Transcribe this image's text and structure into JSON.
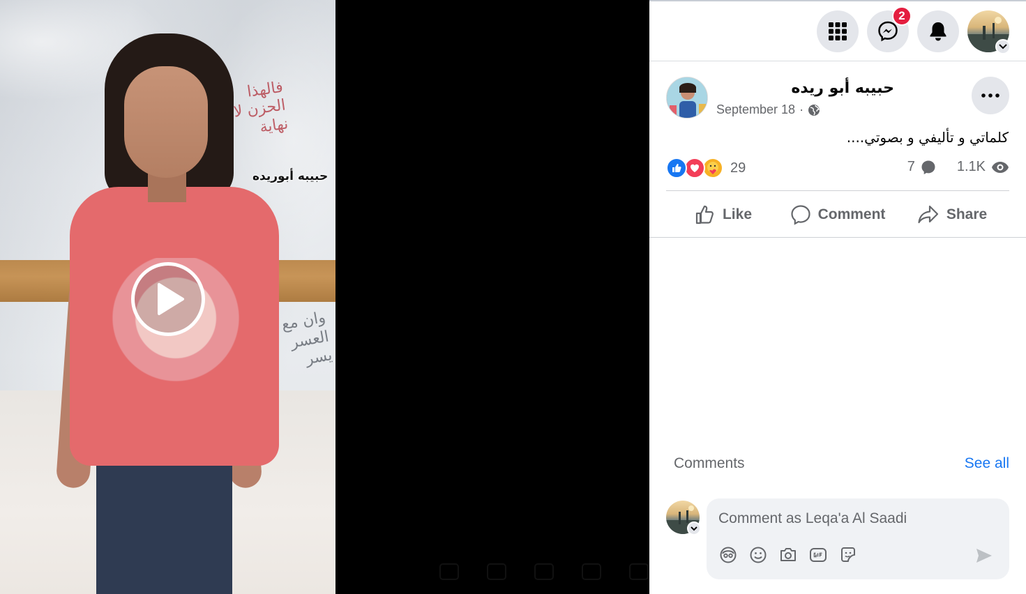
{
  "video": {
    "watermark": "حبيبه أبوريده",
    "wall_writing_1": "فالهذا الحزن لا نهاية",
    "wall_writing_2": "وان مع العسر يسر",
    "play_label": "Play video"
  },
  "topbar": {
    "menu_icon": "grid-menu-icon",
    "messenger_icon": "messenger-icon",
    "messenger_badge": "2",
    "notifications_icon": "bell-icon",
    "account_icon": "profile-avatar"
  },
  "post": {
    "author": "حبيبه أبو ريده",
    "date": "September 18",
    "separator": "·",
    "privacy_icon": "globe-icon",
    "caption": "كلماتي و تأليفي و بصوتي....",
    "reaction_count": "29",
    "comment_count": "7",
    "view_count": "1.1K",
    "reaction_types": [
      "like",
      "love",
      "care"
    ]
  },
  "actions": {
    "like": "Like",
    "comment": "Comment",
    "share": "Share"
  },
  "comments": {
    "heading": "Comments",
    "see_all": "See all",
    "placeholder": "Comment as Leqa'a Al Saadi"
  },
  "colors": {
    "accent": "#1877f2",
    "badge": "#e41e3f",
    "muted_text": "#65676b",
    "button_bg": "#e4e6eb"
  }
}
